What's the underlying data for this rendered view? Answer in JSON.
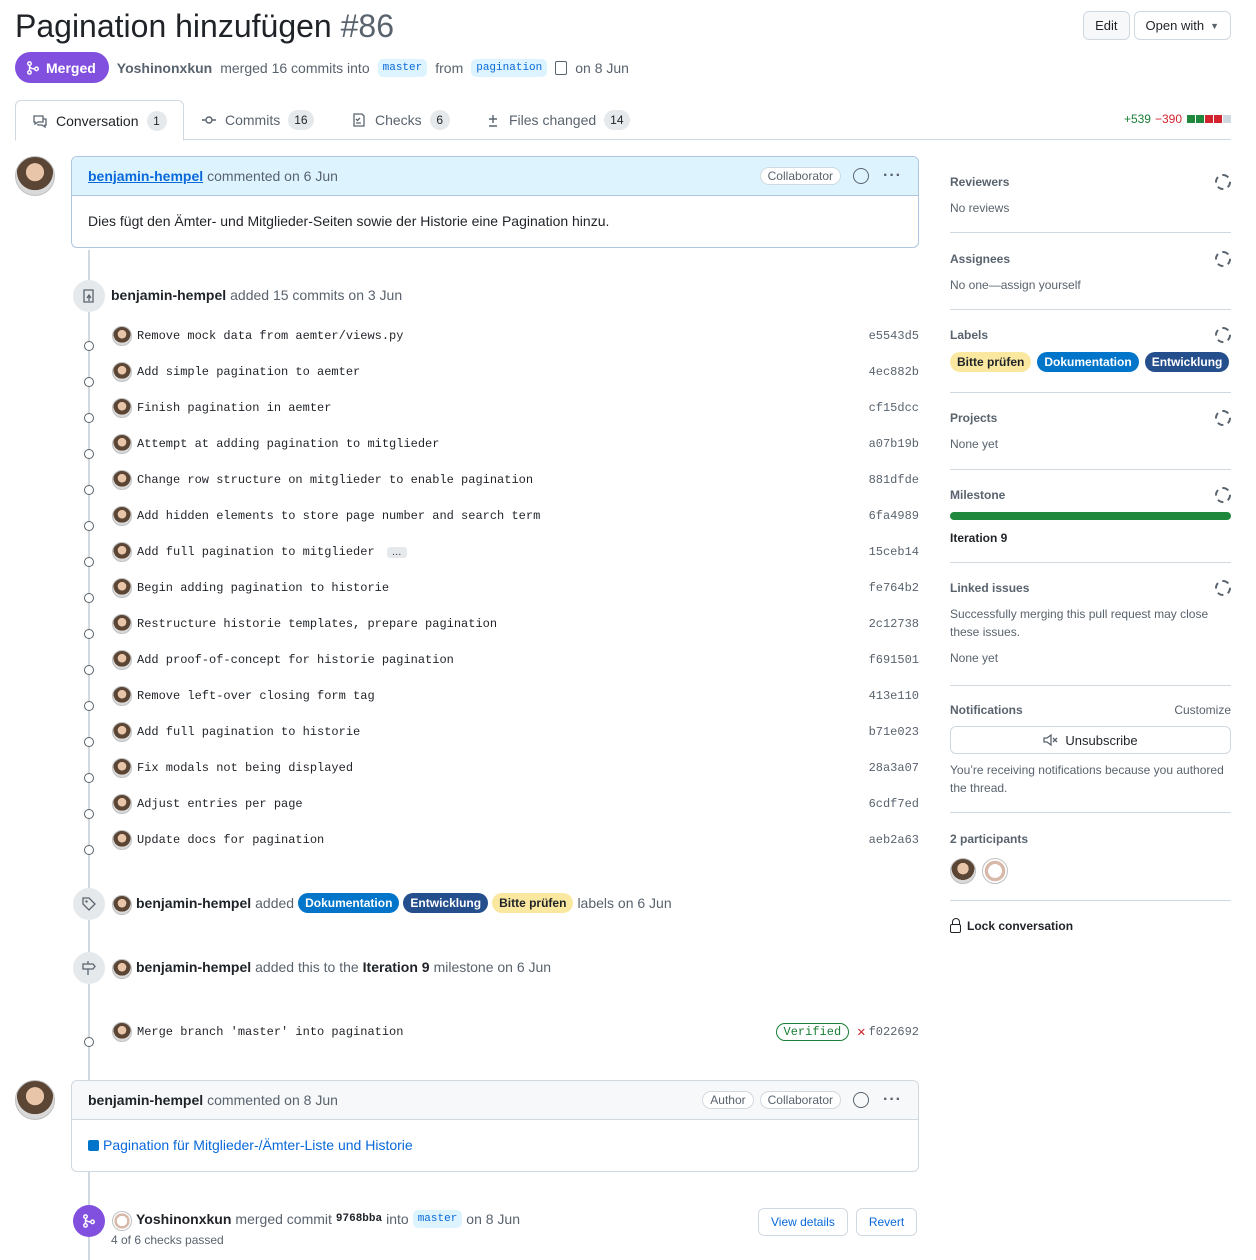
{
  "header": {
    "title": "Pagination hinzufügen",
    "number": "#86",
    "edit_label": "Edit",
    "open_with_label": "Open with"
  },
  "state": {
    "label": "Merged",
    "author": "Yoshinonxkun",
    "text_merged": "merged 16 commits into",
    "base_branch": "master",
    "text_from": "from",
    "head_branch": "pagination",
    "date": "on 8 Jun"
  },
  "tabs": [
    {
      "label": "Conversation",
      "count": "1"
    },
    {
      "label": "Commits",
      "count": "16"
    },
    {
      "label": "Checks",
      "count": "6"
    },
    {
      "label": "Files changed",
      "count": "14"
    }
  ],
  "diffstat": {
    "additions": "+539",
    "deletions": "−390"
  },
  "comment1": {
    "author": "benjamin-hempel",
    "meta": "commented on 6 Jun",
    "role": "Collaborator",
    "body": "Dies fügt den Ämter- und Mitglieder-Seiten sowie der Historie eine Pagination hinzu."
  },
  "commit_event": {
    "author": "benjamin-hempel",
    "text": "added 15 commits on 3 Jun"
  },
  "commits": [
    {
      "msg": "Remove mock data from aemter/views.py",
      "sha": "e5543d5"
    },
    {
      "msg": "Add simple pagination to aemter",
      "sha": "4ec882b"
    },
    {
      "msg": "Finish pagination in aemter",
      "sha": "cf15dcc"
    },
    {
      "msg": "Attempt at adding pagination to mitglieder",
      "sha": "a07b19b"
    },
    {
      "msg": "Change row structure on mitglieder to enable pagination",
      "sha": "881dfde"
    },
    {
      "msg": "Add hidden elements to store page number and search term",
      "sha": "6fa4989"
    },
    {
      "msg": "Add full pagination to mitglieder",
      "sha": "15ceb14",
      "ellipsis": "…"
    },
    {
      "msg": "Begin adding pagination to historie",
      "sha": "fe764b2"
    },
    {
      "msg": "Restructure historie templates, prepare pagination",
      "sha": "2c12738"
    },
    {
      "msg": "Add proof-of-concept for historie pagination",
      "sha": "f691501"
    },
    {
      "msg": "Remove left-over closing form tag",
      "sha": "413e110"
    },
    {
      "msg": "Add full pagination to historie",
      "sha": "b71e023"
    },
    {
      "msg": "Fix modals not being displayed",
      "sha": "28a3a07"
    },
    {
      "msg": "Adjust entries per page",
      "sha": "6cdf7ed"
    },
    {
      "msg": "Update docs for pagination",
      "sha": "aeb2a63"
    }
  ],
  "label_event": {
    "author": "benjamin-hempel",
    "added": "added",
    "labels": [
      "Dokumentation",
      "Entwicklung",
      "Bitte prüfen"
    ],
    "suffix": "labels on 6 Jun"
  },
  "milestone_event": {
    "author": "benjamin-hempel",
    "text1": "added this to the",
    "milestone": "Iteration 9",
    "text2": "milestone on 6 Jun"
  },
  "merge_branch_commit": {
    "msg": "Merge branch 'master' into pagination",
    "verified": "Verified",
    "sha": "f022692"
  },
  "comment2": {
    "author": "benjamin-hempel",
    "meta": "commented on 8 Jun",
    "role1": "Author",
    "role2": "Collaborator",
    "link": "Pagination für Mitglieder-/Ämter-Liste und Historie"
  },
  "merge_event": {
    "author": "Yoshinonxkun",
    "text1": "merged commit",
    "sha": "9768bba",
    "text2": "into",
    "branch": "master",
    "date": "on 8 Jun",
    "checks": "4 of 6 checks passed",
    "view_details": "View details",
    "revert": "Revert"
  },
  "sidebar": {
    "reviewers": {
      "title": "Reviewers",
      "value": "No reviews"
    },
    "assignees": {
      "title": "Assignees",
      "value": "No one—assign yourself"
    },
    "labels": {
      "title": "Labels",
      "items": [
        "Bitte prüfen",
        "Dokumentation",
        "Entwicklung"
      ]
    },
    "projects": {
      "title": "Projects",
      "value": "None yet"
    },
    "milestone": {
      "title": "Milestone",
      "name": "Iteration 9",
      "progress": 1.0
    },
    "linked": {
      "title": "Linked issues",
      "desc": "Successfully merging this pull request may close these issues.",
      "value": "None yet"
    },
    "notifications": {
      "title": "Notifications",
      "customize": "Customize",
      "button": "Unsubscribe",
      "desc": "You’re receiving notifications because you authored the thread."
    },
    "participants": {
      "title": "2 participants"
    },
    "lock": "Lock conversation"
  },
  "colors": {
    "merged": "#8250df",
    "accent": "#0969da",
    "green": "#1f883d",
    "label_doc": "#0075ca",
    "label_dev": "#254e8c",
    "label_bp": "#fbe8a0"
  }
}
